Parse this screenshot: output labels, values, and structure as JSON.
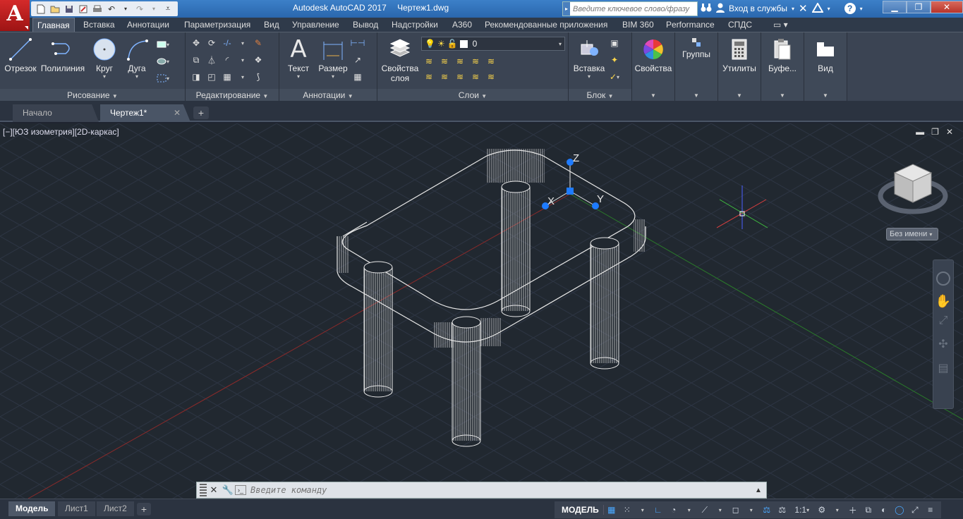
{
  "app": {
    "logo_letter": "A",
    "title": "Autodesk AutoCAD 2017",
    "file": "Чертеж1.dwg",
    "search_placeholder": "Введите ключевое слово/фразу",
    "signin": "Вход в службы"
  },
  "ribbon_tabs": [
    "Главная",
    "Вставка",
    "Аннотации",
    "Параметризация",
    "Вид",
    "Управление",
    "Вывод",
    "Надстройки",
    "A360",
    "Рекомендованные приложения",
    "BIM 360",
    "Performance",
    "СПДС"
  ],
  "panels": {
    "draw": {
      "title": "Рисование",
      "line": "Отрезок",
      "polyline": "Полилиния",
      "circle": "Круг",
      "arc": "Дуга"
    },
    "modify": {
      "title": "Редактирование"
    },
    "annotation": {
      "title": "Аннотации",
      "text": "Текст",
      "dimension": "Размер"
    },
    "layers": {
      "title": "Слои",
      "layer_props_line1": "Свойства",
      "layer_props_line2": "слоя",
      "current_layer": "0"
    },
    "block": {
      "title": "Блок",
      "insert": "Вставка"
    },
    "properties": {
      "label": "Свойства"
    },
    "groups": {
      "label": "Группы"
    },
    "utilities": {
      "label": "Утилиты"
    },
    "clipboard": {
      "label": "Буфе..."
    },
    "view": {
      "label": "Вид"
    }
  },
  "doc_tabs": {
    "start": "Начало",
    "drawing": "Чертеж1*"
  },
  "viewport": {
    "label": "[−][ЮЗ изометрия][2D-каркас]",
    "ucs_name": "Без имени",
    "axis_x": "X",
    "axis_y": "Y",
    "axis_z": "Z"
  },
  "command": {
    "placeholder": "Введите команду"
  },
  "layout_tabs": [
    "Модель",
    "Лист1",
    "Лист2"
  ],
  "status": {
    "model": "МОДЕЛЬ",
    "scale": "1:1"
  },
  "colors": {
    "accent": "#2a67ad",
    "background": "#212830",
    "wire": "#e8e8e8",
    "grip": "#1e7bff"
  }
}
